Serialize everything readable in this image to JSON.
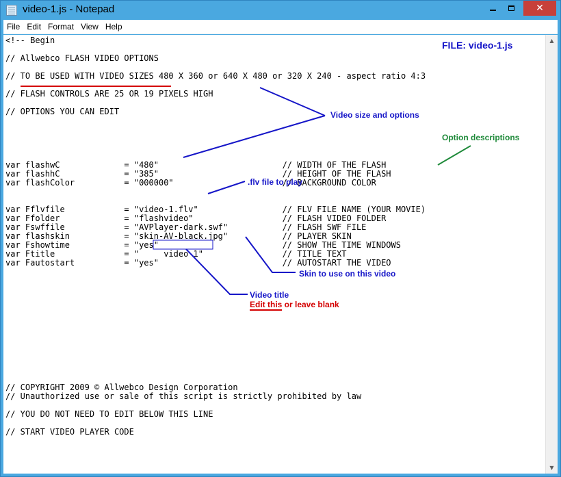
{
  "window": {
    "title": "video-1.js - Notepad",
    "minimize_glyph": "min",
    "maximize_glyph": "max",
    "close_glyph": "✕"
  },
  "menu": [
    {
      "label": "File"
    },
    {
      "label": "Edit"
    },
    {
      "label": "Format"
    },
    {
      "label": "View"
    },
    {
      "label": "Help"
    }
  ],
  "document": {
    "lines": [
      "<!-- Begin",
      "",
      "// Allwebco FLASH VIDEO OPTIONS",
      "",
      "// TO BE USED WITH VIDEO SIZES 480 X 360 or 640 X 480 or 320 X 240 - aspect ratio 4:3",
      "",
      "// FLASH CONTROLS ARE 25 OR 19 PIXELS HIGH",
      "",
      "// OPTIONS YOU CAN EDIT",
      "",
      "",
      "",
      "",
      "",
      "var flashwC             = \"480\"                         // WIDTH OF THE FLASH",
      "var flashhC             = \"385\"                         // HEIGHT OF THE FLASH",
      "var flashColor          = \"000000\"                      // BACKGROUND COLOR",
      "",
      "",
      "var Fflvfile            = \"video-1.flv\"                 // FLV FILE NAME (YOUR MOVIE)",
      "var Ffolder             = \"flashvideo\"                  // FLASH VIDEO FOLDER",
      "var Fswffile            = \"AVPlayer-dark.swf\"           // FLASH SWF FILE",
      "var flashskin           = \"skin-AV-black.jpg\"           // PLAYER SKIN",
      "var Fshowtime           = \"yes\"                         // SHOW THE TIME WINDOWS",
      "var Ftitle              = \"     video 1\"                // TITLE TEXT",
      "var Fautostart          = \"yes\"                         // AUTOSTART THE VIDEO",
      "",
      "",
      "",
      "",
      "",
      "",
      "",
      "",
      "",
      "",
      "",
      "",
      "",
      "// COPYRIGHT 2009 © Allwebco Design Corporation",
      "// Unauthorized use or sale of this script is strictly prohibited by law",
      "",
      "// YOU DO NOT NEED TO EDIT BELOW THIS LINE",
      "",
      "// START VIDEO PLAYER CODE"
    ]
  },
  "annotations": {
    "file_label": "FILE: video-1.js",
    "video_size": "Video size and options",
    "option_desc": "Option descriptions",
    "flv_file": ".flv file to play",
    "skin": "Skin to use on this video",
    "video_title": "Video title",
    "edit_hint": "Edit this or leave blank"
  },
  "colors": {
    "titlebar": "#4aa8e0",
    "close_button": "#c7403a",
    "annotation_blue": "#1616c8",
    "annotation_green": "#1f8a3a",
    "annotation_red": "#d40000"
  },
  "icons": {
    "app": "notepad-icon",
    "scroll_up": "arrow-up-icon",
    "scroll_down": "arrow-down-icon"
  }
}
